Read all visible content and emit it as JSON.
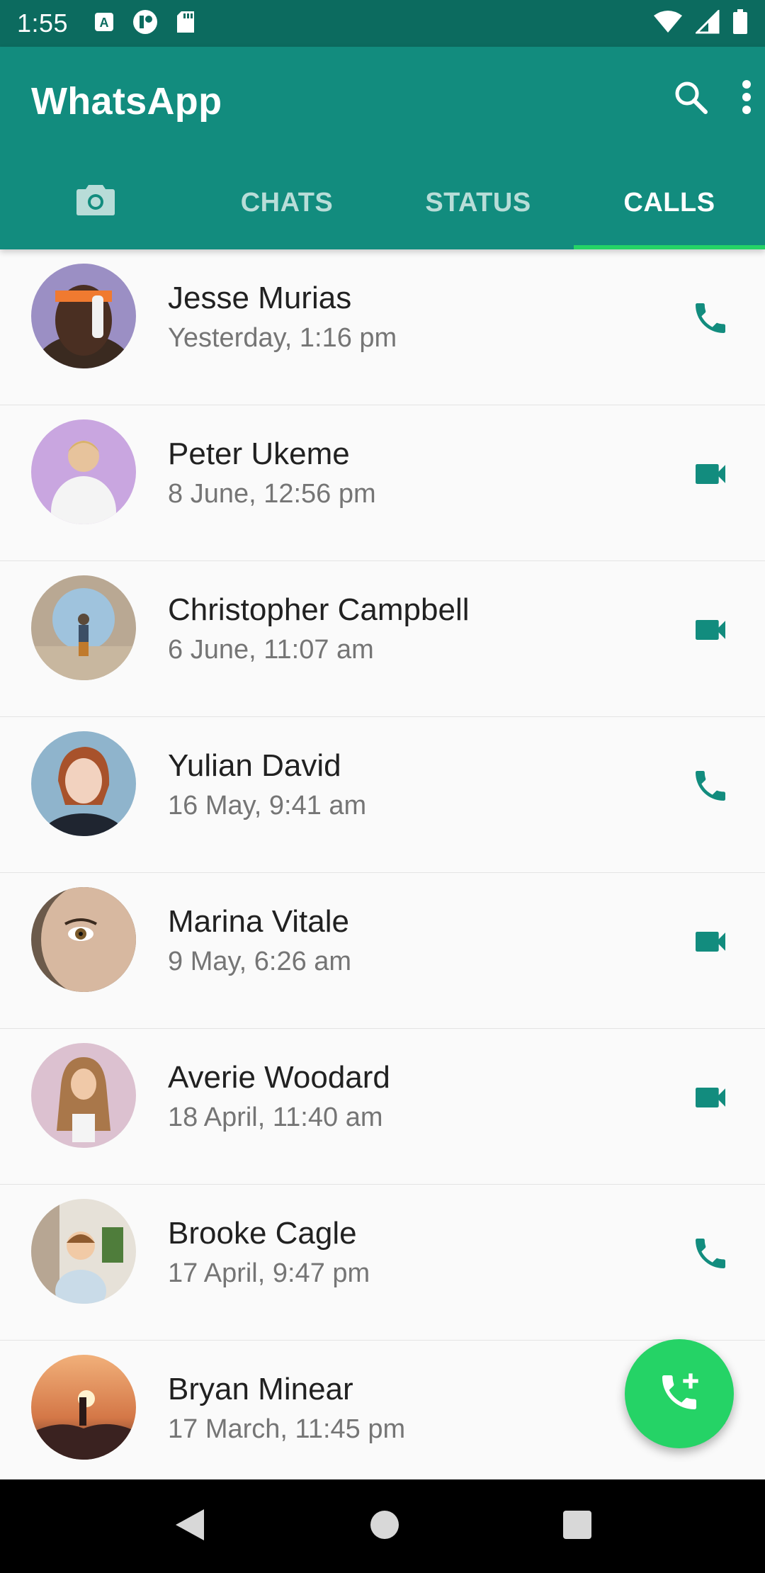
{
  "status_bar": {
    "time": "1:55",
    "left_icons": [
      "accessibility-a-icon",
      "app-notification-icon",
      "sd-card-icon"
    ],
    "right_icons": [
      "wifi-icon",
      "cell-signal-icon",
      "battery-icon"
    ]
  },
  "app_bar": {
    "title": "WhatsApp",
    "actions": [
      "search-icon",
      "more-vert-icon"
    ],
    "color": "#128c7e"
  },
  "tabs": [
    {
      "label": "",
      "icon": "camera-icon"
    },
    {
      "label": "CHATS"
    },
    {
      "label": "STATUS"
    },
    {
      "label": "CALLS",
      "active": true
    }
  ],
  "calls": [
    {
      "name": "Jesse Murias",
      "time": "Yesterday, 1:16 pm",
      "type": "phone-icon"
    },
    {
      "name": "Peter Ukeme",
      "time": "8 June, 12:56 pm",
      "type": "videocam-icon"
    },
    {
      "name": "Christopher Campbell",
      "time": "6 June, 11:07 am",
      "type": "videocam-icon"
    },
    {
      "name": "Yulian David",
      "time": "16 May, 9:41 am",
      "type": "phone-icon"
    },
    {
      "name": "Marina Vitale",
      "time": "9 May, 6:26 am",
      "type": "videocam-icon"
    },
    {
      "name": "Averie Woodard",
      "time": "18 April, 11:40 am",
      "type": "videocam-icon"
    },
    {
      "name": "Brooke Cagle",
      "time": "17 April, 9:47 pm",
      "type": "phone-icon"
    },
    {
      "name": "Bryan Minear",
      "time": "17 March, 11:45 pm",
      "type": "phone-icon"
    }
  ],
  "fab": {
    "icon": "add-call-icon",
    "color": "#25d366"
  },
  "accent_color": "#128c7e"
}
